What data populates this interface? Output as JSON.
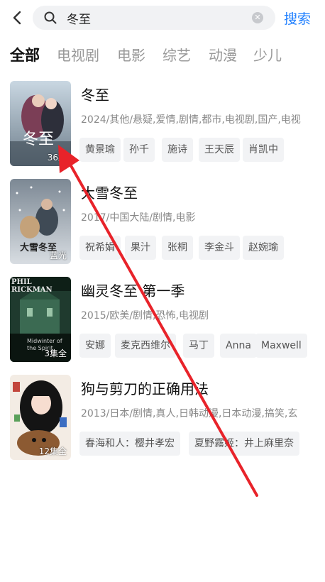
{
  "header": {
    "search_query": "冬至",
    "search_button": "搜索"
  },
  "tabs": [
    "全部",
    "电视剧",
    "电影",
    "综艺",
    "动漫",
    "少儿"
  ],
  "results": [
    {
      "title": "冬至",
      "meta": "2024/其他/悬疑,爱情,剧情,都市,电视剧,国产,电视",
      "badge": "36集",
      "poster_text": "冬至",
      "tags": [
        "黄景瑜",
        "孙千",
        "施诗",
        "王天辰",
        "肖凯中"
      ]
    },
    {
      "title": "大雪冬至",
      "meta": "2017/中国大陆/剧情,电影",
      "badge": "蓝光",
      "poster_text": "大雪冬至",
      "tags": [
        "祝希娟",
        "果汁",
        "张桐",
        "李金斗",
        "赵婉瑜"
      ]
    },
    {
      "title": "幽灵冬至 第一季",
      "meta": "2015/欧美/剧情,恐怖,电视剧",
      "badge": "3集全",
      "poster_text": "PHIL RICKMAN",
      "poster_subtext": "Midwinter of the Spirit",
      "tags": [
        "安娜",
        "麦克西维尔",
        "马丁",
        "Anna",
        "Maxwell"
      ]
    },
    {
      "title": "狗与剪刀的正确用法",
      "meta": "2013/日本/剧情,真人,日韩动漫,日本动漫,搞笑,玄",
      "badge": "12集全",
      "tags": [
        "春海和人：樱井孝宏",
        "夏野霧姬：井上麻里奈"
      ]
    }
  ],
  "colors": {
    "accent": "#1f7fff",
    "arrow": "#e8232a"
  }
}
